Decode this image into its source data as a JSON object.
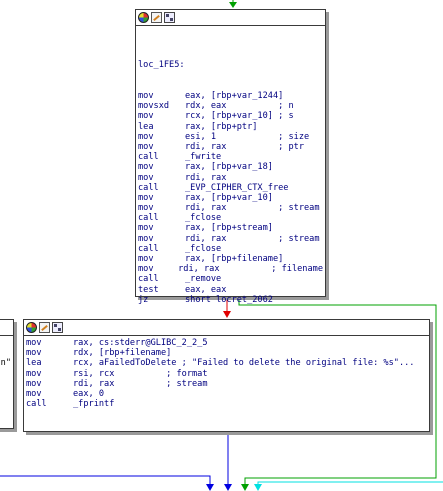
{
  "top_node": {
    "label": "loc_1FE5:",
    "lines": [
      {
        "mn": "mov",
        "ops": "eax, [rbp+var_1244]"
      },
      {
        "mn": "movsxd",
        "ops": "rdx, eax          ; n"
      },
      {
        "mn": "mov",
        "ops": "rcx, [rbp+var_10] ; s"
      },
      {
        "mn": "lea",
        "ops": "rax, [rbp+ptr]"
      },
      {
        "mn": "mov",
        "ops": "esi, 1            ; size"
      },
      {
        "mn": "mov",
        "ops": "rdi, rax          ; ptr"
      },
      {
        "mn": "call",
        "ops": "_fwrite"
      },
      {
        "mn": "mov",
        "ops": "rax, [rbp+var_18]"
      },
      {
        "mn": "mov",
        "ops": "rdi, rax"
      },
      {
        "mn": "call",
        "ops": "_EVP_CIPHER_CTX_free"
      },
      {
        "mn": "mov",
        "ops": "rax, [rbp+var_10]"
      },
      {
        "mn": "mov",
        "ops": "rdi, rax          ; stream"
      },
      {
        "mn": "call",
        "ops": "_fclose"
      },
      {
        "mn": "mov",
        "ops": "rax, [rbp+stream]"
      },
      {
        "mn": "mov",
        "ops": "rdi, rax          ; stream"
      },
      {
        "mn": "call",
        "ops": "_fclose"
      },
      {
        "mn": "mov",
        "ops": "rax, [rbp+filename]"
      },
      {
        "mn": "mov",
        "ops": "rdi, rax          ; filename"
      },
      {
        "mn": "call",
        "ops": "_remove"
      },
      {
        "mn": "test",
        "ops": "eax, eax"
      },
      {
        "mn": "jz",
        "ops": "short locret_2062"
      }
    ]
  },
  "bottom_node": {
    "lines": [
      {
        "mn": "mov",
        "ops": "rax, cs:stderr@GLIBC_2_2_5"
      },
      {
        "mn": "mov",
        "ops": "rdx, [rbp+filename]"
      },
      {
        "mn": "lea",
        "ops": "rcx, aFailedToDelete ; \"Failed to delete the original file: %s\"..."
      },
      {
        "mn": "mov",
        "ops": "rsi, rcx          ; format"
      },
      {
        "mn": "mov",
        "ops": "rdi, rax          ; stream"
      },
      {
        "mn": "mov",
        "ops": "eax, 0"
      },
      {
        "mn": "call",
        "ops": "_fprintf"
      }
    ]
  },
  "left_node_fragment": {
    "lines": [
      {
        "text": ""
      },
      {
        "text": ""
      },
      {
        "text": "an\""
      },
      {
        "text": ""
      },
      {
        "text": ""
      },
      {
        "text": ""
      },
      {
        "text": ""
      }
    ]
  },
  "colors": {
    "edge_true": "#00a000",
    "edge_false": "#e00000",
    "edge_uncond": "#0000e0",
    "edge_cyan": "#00e0e0"
  }
}
